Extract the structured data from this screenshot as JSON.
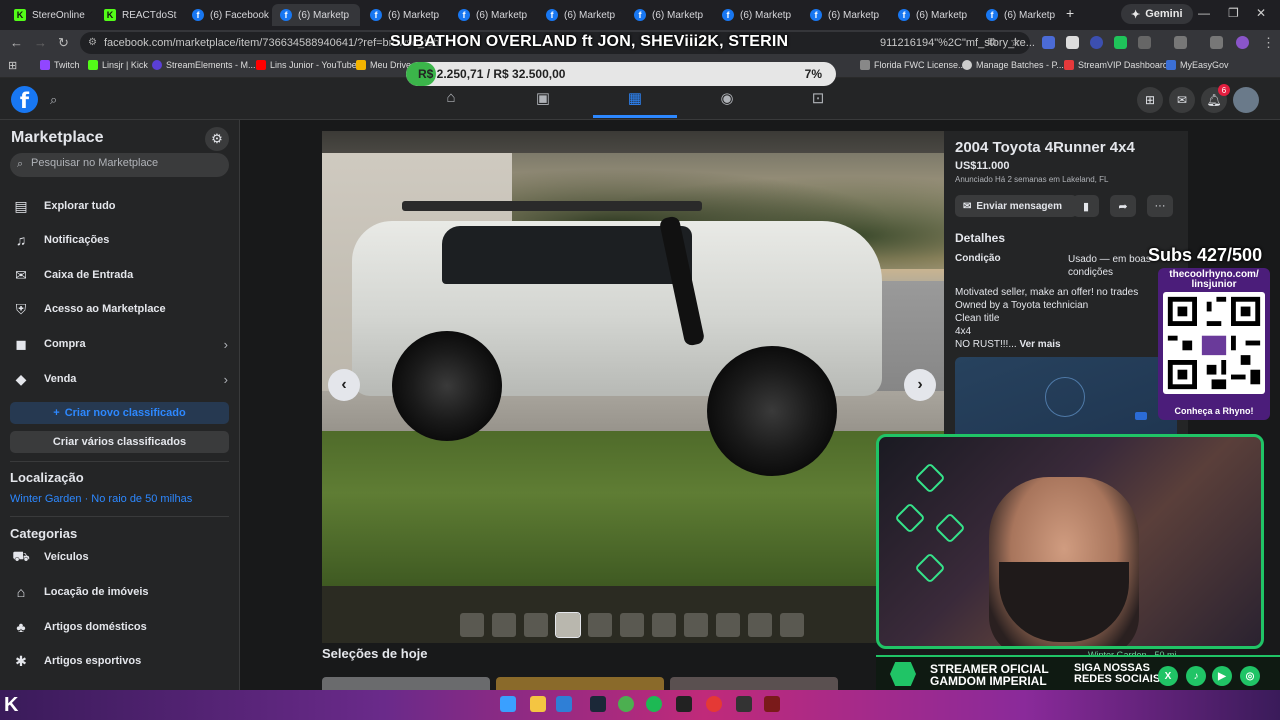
{
  "browser": {
    "tabs": [
      {
        "label": "StereOnline",
        "favicon": "K"
      },
      {
        "label": "REACTdoSt",
        "favicon": "K"
      },
      {
        "label": "(6) Facebook",
        "favicon": "f"
      },
      {
        "label": "(6) Marketp",
        "favicon": "f"
      },
      {
        "label": "(6) Marketp",
        "favicon": "f"
      },
      {
        "label": "(6) Marketp",
        "favicon": "f"
      },
      {
        "label": "(6) Marketp",
        "favicon": "f"
      },
      {
        "label": "(6) Marketp",
        "favicon": "f"
      },
      {
        "label": "(6) Marketp",
        "favicon": "f"
      },
      {
        "label": "(6) Marketp",
        "favicon": "f"
      },
      {
        "label": "(6) Marketp",
        "favicon": "f"
      },
      {
        "label": "(6) Marketp",
        "favicon": "f"
      }
    ],
    "new_tab": "+",
    "gemini_label": "Gemini",
    "url": "facebook.com/marketplace/item/736634588940641/?ref=browse_tab",
    "url_tail": "911216194\"%2C\"mf_story_ke...",
    "bookmarks": [
      "Twitch",
      "Linsjr | Kick",
      "StreamElements - M...",
      "Lins Junior - YouTube",
      "Meu Drive",
      "Florida FWC License...",
      "Manage Batches - P...",
      "StreamVIP Dashboard",
      "MyEasyGov"
    ]
  },
  "stream": {
    "title": "SUBATHON OVERLAND ft JON, SHEViii2K, STERIN",
    "goal_text": "R$ 2.250,71 / R$ 32.500,00",
    "goal_percent": "7%",
    "goal_fraction": 0.07,
    "subs": "Subs 427/500",
    "qr_handle": "thecoolrhyno.com/ linsjunior",
    "qr_caption": "Conheça a Rhyno!",
    "cam_location": "Winter Garden · 50 mi",
    "sponsor_line1": "STREAMER OFICIAL",
    "sponsor_line2": "GAMDOM IMPERIAL",
    "social_line1": "SIGA NOSSAS",
    "social_line2": "REDES SOCIAIS"
  },
  "header": {
    "logo": "f",
    "notif_count": "6"
  },
  "sidebar": {
    "title": "Marketplace",
    "search_placeholder": "Pesquisar no Marketplace",
    "items": [
      {
        "label": "Explorar tudo"
      },
      {
        "label": "Notificações"
      },
      {
        "label": "Caixa de Entrada"
      },
      {
        "label": "Acesso ao Marketplace"
      },
      {
        "label": "Compra"
      },
      {
        "label": "Venda"
      }
    ],
    "create_listing": "Criar novo classificado",
    "create_multiple": "Criar vários classificados",
    "location_heading": "Localização",
    "location_value": "Winter Garden · No raio de 50 milhas",
    "categories_heading": "Categorias",
    "categories": [
      {
        "label": "Veículos"
      },
      {
        "label": "Locação de imóveis"
      },
      {
        "label": "Artigos domésticos"
      },
      {
        "label": "Artigos esportivos"
      }
    ]
  },
  "listing": {
    "title": "2004 Toyota 4Runner 4x4",
    "price": "US$11.000",
    "listed": "Anunciado Há 2 semanas em Lakeland, FL",
    "message_button": "Enviar mensagem",
    "details_heading": "Detalhes",
    "condition_label": "Condição",
    "condition_value": "Usado — em boas condições",
    "description": [
      "Motivated seller, make an offer! no trades",
      "Owned by a Toyota technician",
      "Clean title",
      "4x4",
      "NO RUST!!!..."
    ],
    "see_more": "Ver mais",
    "thumbnail_count": 11,
    "selected_thumbnail": 4
  },
  "main": {
    "today_heading": "Seleções de hoje"
  },
  "colors": {
    "fb_blue": "#1877f2",
    "accent": "#2d88ff",
    "stream_green": "#20c466"
  }
}
